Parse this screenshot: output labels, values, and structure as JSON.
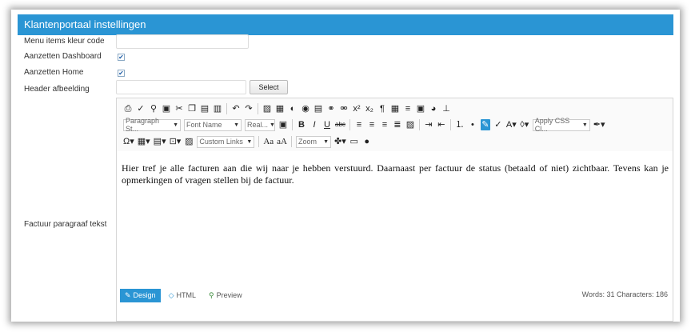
{
  "panel": {
    "title": "Klantenportaal instellingen"
  },
  "fields": {
    "menu_color": {
      "label": "Menu items kleur code",
      "value": ""
    },
    "dashboard": {
      "label": "Aanzetten Dashboard",
      "checked": true
    },
    "home": {
      "label": "Aanzetten Home",
      "checked": true
    },
    "header_image": {
      "label": "Header afbeelding",
      "value": "",
      "button": "Select"
    },
    "invoice_text": {
      "label": "Factuur paragraaf tekst"
    }
  },
  "editor": {
    "toolbar": {
      "paragraph_style": "Paragraph St...",
      "font_name": "Font Name",
      "font_size": "Real...",
      "apply_css": "Apply CSS Cl...",
      "custom_links": "Custom Links",
      "zoom": "Zoom"
    },
    "content": "Hier tref je alle facturen aan die wij naar je hebben verstuurd. Daarnaast per factuur de status (betaald of niet) zichtbaar. Tevens kan je opmerkingen of vragen stellen bij de factuur.",
    "tabs": {
      "design": "Design",
      "html": "HTML",
      "preview": "Preview"
    },
    "stats": "Words: 31   Characters: 186"
  },
  "colors": {
    "accent": "#2a95d4"
  }
}
